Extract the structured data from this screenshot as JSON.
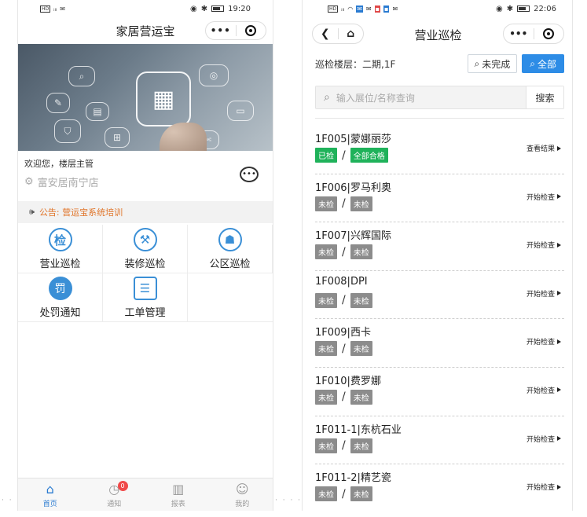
{
  "left": {
    "status": {
      "time": "19:20"
    },
    "nav": {
      "title": "家居营运宝",
      "more": "•••"
    },
    "welcome": "欢迎您，楼层主管",
    "store": "富安居南宁店",
    "notice": "公告: 营运宝系统培训",
    "grid": [
      {
        "label": "营业巡检",
        "icon": "检"
      },
      {
        "label": "装修巡检",
        "icon": "⚒"
      },
      {
        "label": "公区巡检",
        "icon": "☗"
      },
      {
        "label": "处罚通知",
        "icon": "罚"
      },
      {
        "label": "工单管理",
        "icon": "☰"
      }
    ],
    "tabs": [
      {
        "label": "首页",
        "icon": "⌂"
      },
      {
        "label": "通知",
        "icon": "◷",
        "badge": "0"
      },
      {
        "label": "报表",
        "icon": "▥"
      },
      {
        "label": "我的",
        "icon": "☺"
      }
    ]
  },
  "right": {
    "status": {
      "time": "22:06"
    },
    "nav": {
      "title": "营业巡检",
      "more": "•••"
    },
    "filter": {
      "label": "巡检楼层：二期,1F",
      "incomplete": "未完成",
      "all": "全部"
    },
    "search": {
      "placeholder": "输入展位/名称查询",
      "button": "搜索"
    },
    "items": [
      {
        "name": "1F005|蒙娜丽莎",
        "tag1": "已检",
        "tag2": "全部合格",
        "action": "查看结果",
        "done": true
      },
      {
        "name": "1F006|罗马利奥",
        "tag1": "未检",
        "tag2": "未检",
        "action": "开始检查",
        "done": false
      },
      {
        "name": "1F007|兴辉国际",
        "tag1": "未检",
        "tag2": "未检",
        "action": "开始检查",
        "done": false
      },
      {
        "name": "1F008|DPI",
        "tag1": "未检",
        "tag2": "未检",
        "action": "开始检查",
        "done": false
      },
      {
        "name": "1F009|西卡",
        "tag1": "未检",
        "tag2": "未检",
        "action": "开始检查",
        "done": false
      },
      {
        "name": "1F010|费罗娜",
        "tag1": "未检",
        "tag2": "未检",
        "action": "开始检查",
        "done": false
      },
      {
        "name": "1F011-1|东杭石业",
        "tag1": "未检",
        "tag2": "未检",
        "action": "开始检查",
        "done": false
      },
      {
        "name": "1F011-2|精艺瓷",
        "tag1": "未检",
        "tag2": "未检",
        "action": "开始检查",
        "done": false
      }
    ]
  }
}
